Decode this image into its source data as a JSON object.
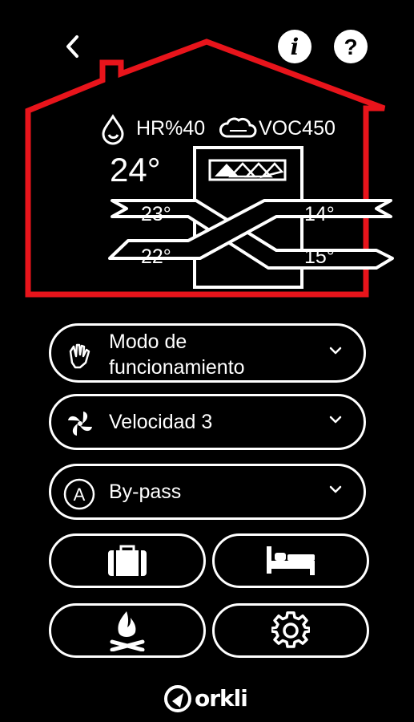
{
  "header": {
    "back_icon": "chevron-left-icon",
    "info_icon": "info-icon",
    "help_icon": "help-icon",
    "info_glyph": "i",
    "help_glyph": "?"
  },
  "house": {
    "outline_color": "#e8141b",
    "humidity_label": "HR%40",
    "voc_label": "VOC450",
    "room_temperature": "24°",
    "flows": {
      "supply_in": "23°",
      "outdoor_in": "14°",
      "extract_out": "22°",
      "exhaust_out": "15°"
    }
  },
  "controls": {
    "mode": {
      "line1": "Modo de",
      "line2": "funcionamiento",
      "icon": "hand-icon"
    },
    "speed": {
      "label": "Velocidad 3",
      "icon": "fan-icon"
    },
    "bypass": {
      "label": "By-pass",
      "icon": "bypass-auto-icon",
      "badge": "A"
    },
    "quick_buttons": [
      {
        "name": "holiday",
        "icon": "suitcase-icon"
      },
      {
        "name": "sleep",
        "icon": "bed-icon"
      },
      {
        "name": "fireplace",
        "icon": "campfire-icon"
      },
      {
        "name": "settings",
        "icon": "gear-icon"
      }
    ]
  },
  "footer": {
    "brand": "orkli"
  }
}
